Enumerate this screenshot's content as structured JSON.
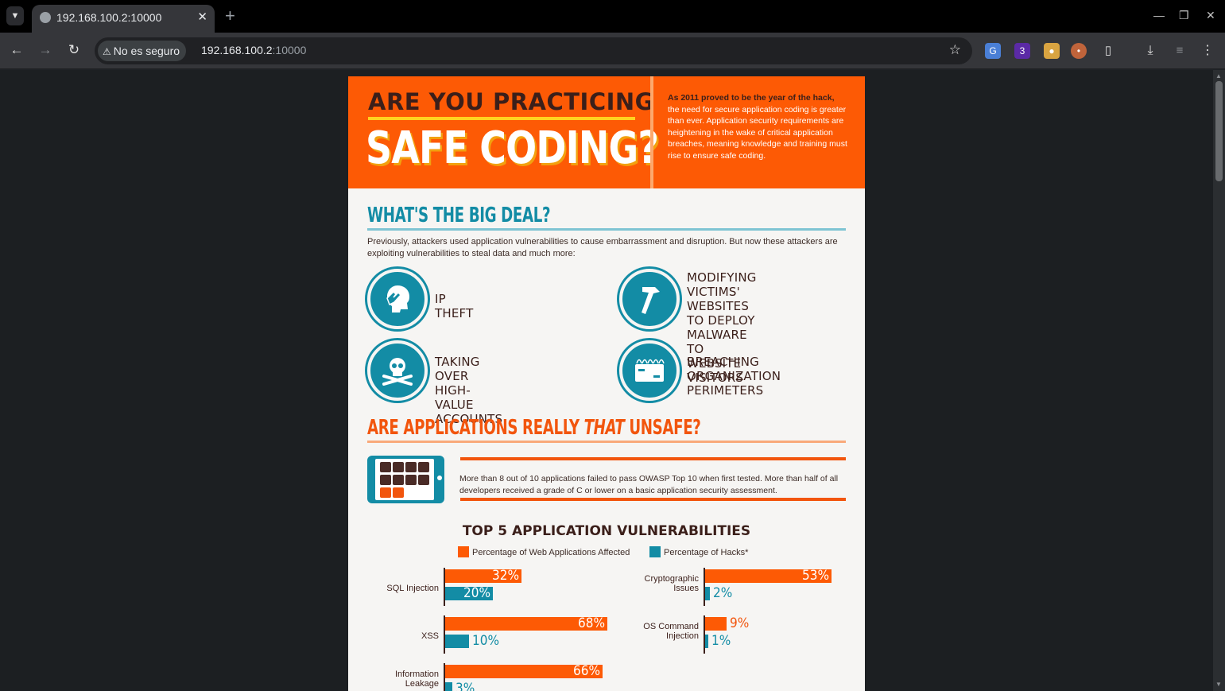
{
  "browser": {
    "tab_title": "192.168.100.2:10000",
    "security_label": "No es seguro",
    "url_host": "192.168.100.2",
    "url_port": ":10000",
    "extension_badge": "3"
  },
  "hero": {
    "top_line": "ARE YOU PRACTICING",
    "main_line": "SAFE CODING?",
    "intro_bold": "As 2011 proved to be the year of the hack,",
    "intro_rest": "the need for secure application coding is greater than ever. Application security requirements are heightening in the wake of critical application breaches, meaning knowledge and training must rise to ensure safe coding."
  },
  "big_deal": {
    "title": "WHAT'S THE BIG DEAL?",
    "intro": "Previously, attackers used application vulnerabilities to cause embarrassment and disruption. But now these attackers are exploiting vulnerabilities to steal data and much more:",
    "threats": [
      {
        "label": "IP THEFT",
        "icon": "head-hand-icon"
      },
      {
        "label": "MODIFYING VICTIMS' WEBSITES TO DEPLOY MALWARE TO WEBSITE VISITORS",
        "icon": "hammer-icon"
      },
      {
        "label": "TAKING OVER HIGH-VALUE ACCOUNTS",
        "icon": "skull-crossbones-icon"
      },
      {
        "label": "BREACHING ORGANIZATION PERIMETERS",
        "icon": "fence-icon"
      }
    ]
  },
  "unsafe": {
    "title_pre": "ARE APPLICATIONS REALLY ",
    "title_em": "THAT",
    "title_post": " UNSAFE?",
    "stat": "More than 8 out of 10 applications failed to pass OWASP Top 10 when first tested. More than half of all developers received a grade of C or lower on a basic application security assessment."
  },
  "chart_data": {
    "type": "bar",
    "title": "TOP 5 APPLICATION VULNERABILITIES",
    "legend": [
      "Percentage of Web Applications Affected",
      "Percentage of Hacks*"
    ],
    "colors": {
      "affected": "#fd5a05",
      "hacks": "#138ca5"
    },
    "categories": [
      {
        "name": "SQL Injection",
        "affected": 32,
        "hacks": 20,
        "affected_label": "32%",
        "hacks_label": "20%"
      },
      {
        "name": "XSS",
        "affected": 68,
        "hacks": 10,
        "affected_label": "68%",
        "hacks_label": "10%"
      },
      {
        "name": "Information Leakage",
        "affected": 66,
        "hacks": 3,
        "affected_label": "66%",
        "hacks_label": "3%"
      },
      {
        "name": "Cryptographic Issues",
        "affected": 53,
        "hacks": 2,
        "affected_label": "53%",
        "hacks_label": "2%"
      },
      {
        "name": "OS Command Injection",
        "affected": 9,
        "hacks": 1,
        "affected_label": "9%",
        "hacks_label": "1%"
      }
    ]
  }
}
